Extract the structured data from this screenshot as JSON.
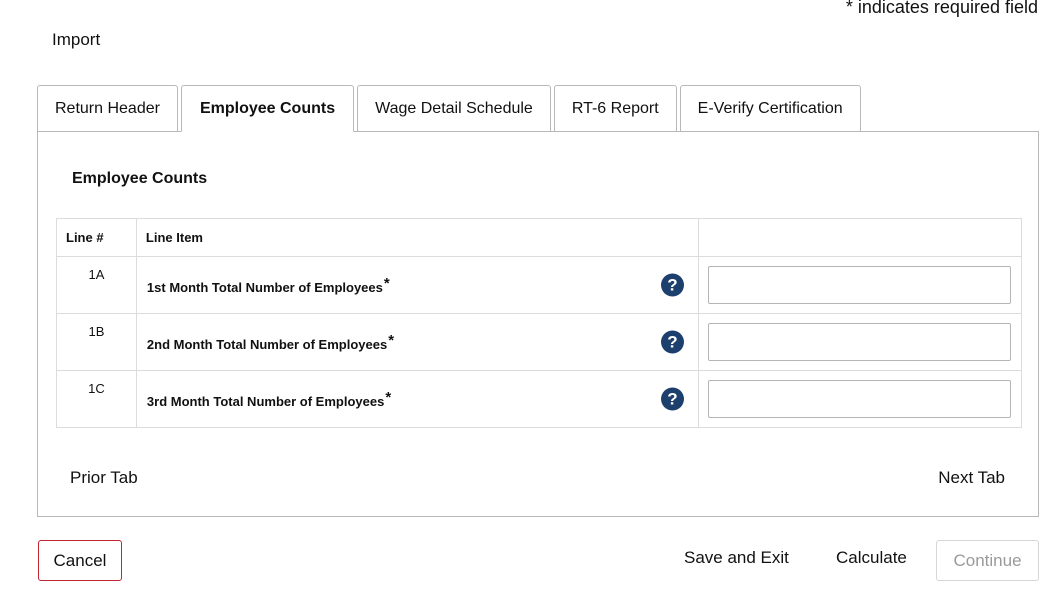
{
  "header": {
    "required_note": "* indicates required field",
    "import_label": "Import"
  },
  "tabs": [
    {
      "label": "Return Header",
      "active": false
    },
    {
      "label": "Employee Counts",
      "active": true
    },
    {
      "label": "Wage Detail Schedule",
      "active": false
    },
    {
      "label": "RT-6 Report",
      "active": false
    },
    {
      "label": "E-Verify Certification",
      "active": false
    }
  ],
  "section": {
    "title": "Employee Counts",
    "columns": {
      "line": "Line #",
      "item": "Line Item",
      "value": ""
    },
    "rows": [
      {
        "line": "1A",
        "item": "1st Month Total Number of Employees",
        "required": "*",
        "value": ""
      },
      {
        "line": "1B",
        "item": "2nd Month Total Number of Employees",
        "required": "*",
        "value": ""
      },
      {
        "line": "1C",
        "item": "3rd Month Total Number of Employees",
        "required": "*",
        "value": ""
      }
    ],
    "help_glyph": "?"
  },
  "nav": {
    "prior_tab": "Prior Tab",
    "next_tab": "Next Tab"
  },
  "actions": {
    "cancel": "Cancel",
    "save_exit": "Save and Exit",
    "calculate": "Calculate",
    "continue": "Continue"
  },
  "colors": {
    "help_icon": "#1d3f6e",
    "cancel_border": "#c5252e",
    "border": "#b8b8b8",
    "disabled_text": "#9a9a9a"
  },
  "icons": {
    "help": "help-question-circle-icon"
  }
}
